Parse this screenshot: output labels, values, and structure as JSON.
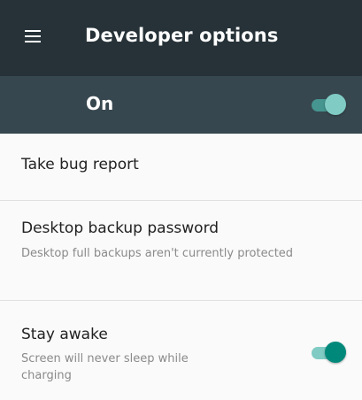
{
  "toolbar": {
    "title": "Developer options",
    "menu_icon": "hamburger-menu-icon"
  },
  "master_switch": {
    "label": "On",
    "state": "on"
  },
  "items": [
    {
      "title": "Take bug report"
    },
    {
      "title": "Desktop backup password",
      "summary": "Desktop full backups aren't currently protected"
    },
    {
      "title": "Stay awake",
      "summary": "Screen will never sleep while charging",
      "toggle": "on"
    }
  ],
  "colors": {
    "toolbar": "#263238",
    "master_bar": "#37474f",
    "accent": "#00897b"
  }
}
